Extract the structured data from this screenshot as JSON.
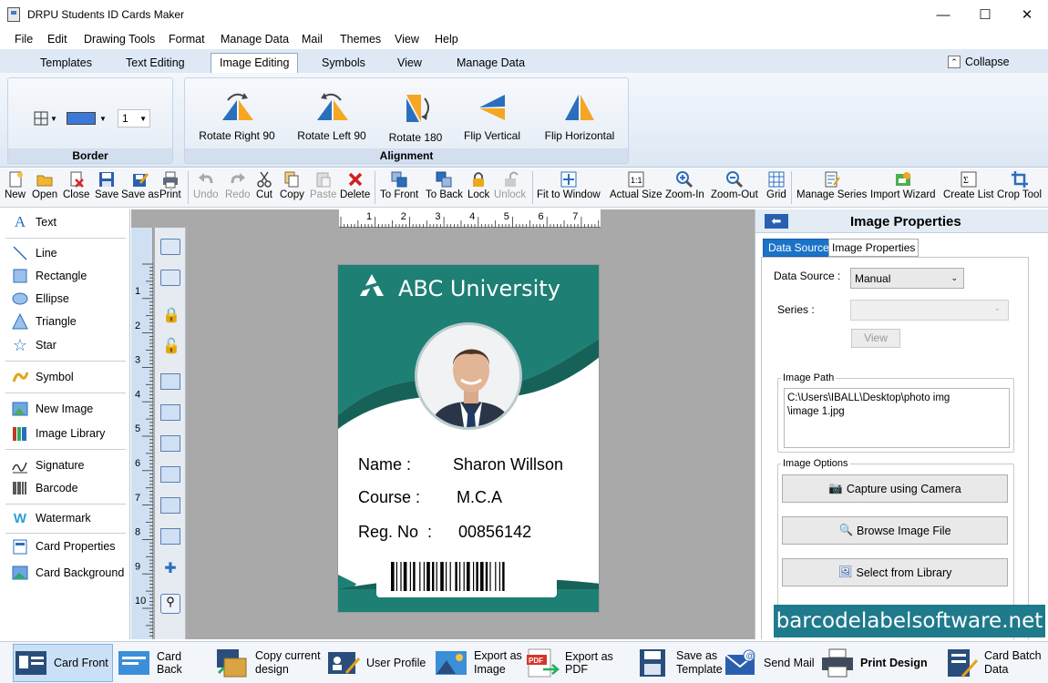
{
  "window": {
    "title": "DRPU Students ID Cards Maker"
  },
  "menu": [
    "File",
    "Edit",
    "Drawing Tools",
    "Format",
    "Manage Data",
    "Mail",
    "Themes",
    "View",
    "Help"
  ],
  "ribbon_tabs": [
    "Templates",
    "Text Editing",
    "Image Editing",
    "Symbols",
    "View",
    "Manage Data"
  ],
  "ribbon_active_tab": "Image Editing",
  "collapse_label": "Collapse",
  "border_group": {
    "label": "Border",
    "color": "#3c78d8",
    "width_value": "1"
  },
  "alignment_group": {
    "label": "Alignment",
    "buttons": [
      "Rotate Right 90",
      "Rotate Left 90",
      "Rotate 180",
      "Flip Vertical",
      "Flip Horizontal"
    ]
  },
  "toolbar": {
    "new": "New",
    "open": "Open",
    "close": "Close",
    "save": "Save",
    "save_as": "Save as",
    "print": "Print",
    "undo": "Undo",
    "redo": "Redo",
    "cut": "Cut",
    "copy": "Copy",
    "paste": "Paste",
    "delete": "Delete",
    "to_front": "To Front",
    "to_back": "To Back",
    "lock": "Lock",
    "unlock": "Unlock",
    "fit": "Fit to Window",
    "actual": "Actual Size",
    "zoom_in": "Zoom-In",
    "zoom_out": "Zoom-Out",
    "grid": "Grid",
    "manage_series": "Manage Series",
    "import_wizard": "Import Wizard",
    "create_list": "Create List",
    "crop_tool": "Crop Tool"
  },
  "left_tools": {
    "text": "Text",
    "line": "Line",
    "rectangle": "Rectangle",
    "ellipse": "Ellipse",
    "triangle": "Triangle",
    "star": "Star",
    "symbol": "Symbol",
    "new_image": "New Image",
    "image_library": "Image Library",
    "signature": "Signature",
    "barcode": "Barcode",
    "watermark": "Watermark",
    "card_properties": "Card Properties",
    "card_background": "Card Background"
  },
  "ruler": {
    "h": [
      "1",
      "2",
      "3",
      "4",
      "5",
      "6",
      "7"
    ],
    "v": [
      "1",
      "2",
      "3",
      "4",
      "5",
      "6",
      "7",
      "8",
      "9",
      "10"
    ]
  },
  "card": {
    "university": "ABC University",
    "name_label": "Name :",
    "name_value": "Sharon Willson",
    "course_label": "Course :",
    "course_value": "M.C.A",
    "reg_label": "Reg. No  :",
    "reg_value": "00856142",
    "accent": "#1e7f74"
  },
  "properties": {
    "title": "Image Properties",
    "tab_data_source": "Data Source",
    "tab_image_properties": "Image Properties",
    "data_source_label": "Data Source :",
    "data_source_value": "Manual",
    "series_label": "Series :",
    "view_button": "View",
    "image_path_label": "Image Path",
    "image_path_value": "C:\\Users\\IBALL\\Desktop\\photo img\n\\image 1.jpg",
    "image_options_label": "Image Options",
    "capture": "Capture using Camera",
    "browse": "Browse Image File",
    "library": "Select from Library"
  },
  "watermark_text": "barcodelabelsoftware.net",
  "bottom": {
    "card_front": "Card Front",
    "card_back": "Card Back",
    "copy_design": "Copy current\ndesign",
    "user_profile": "User Profile",
    "export_image": "Export as\nImage",
    "export_pdf": "Export as PDF",
    "save_template": "Save as\nTemplate",
    "send_mail": "Send Mail",
    "print_design": "Print Design",
    "card_batch": "Card Batch\nData"
  }
}
